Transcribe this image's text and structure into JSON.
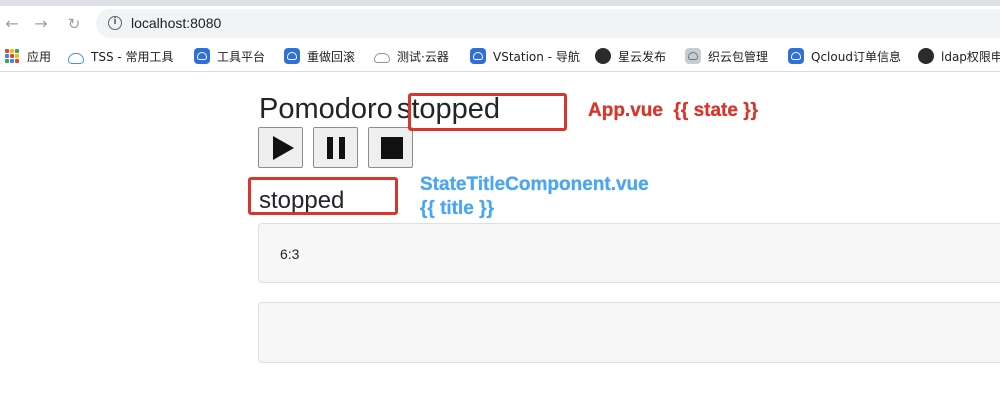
{
  "browser": {
    "url": "localhost:8080",
    "bookmarks": [
      {
        "label": "应用",
        "icon": "apps-grid-icon"
      },
      {
        "label": "TSS - 常用工具",
        "icon": "cloud-icon"
      },
      {
        "label": "工具平台",
        "icon": "blue-cloud-icon"
      },
      {
        "label": "重做回滚",
        "icon": "blue-cloud-icon"
      },
      {
        "label": "测试·云器",
        "icon": "cloud-outline-icon"
      },
      {
        "label": "VStation - 导航",
        "icon": "blue-cloud-icon"
      },
      {
        "label": "星云发布",
        "icon": "dark-circle-icon"
      },
      {
        "label": "织云包管理",
        "icon": "grey-cloud-icon"
      },
      {
        "label": "Qcloud订单信息",
        "icon": "blue-cloud-icon"
      },
      {
        "label": "ldap权限申",
        "icon": "dark-circle-icon"
      }
    ]
  },
  "app": {
    "title": "Pomodoro",
    "state": "stopped",
    "state_title": "stopped",
    "card1_text": "6:3",
    "card2_text": ""
  },
  "annotations": {
    "app_vue": "App.vue  {{ state }}",
    "component_line1": "StateTitleComponent.vue",
    "component_line2": "{{ title }}"
  },
  "colors": {
    "annotation_red": "#d8352b",
    "annotation_blue": "#4aa6f0"
  }
}
